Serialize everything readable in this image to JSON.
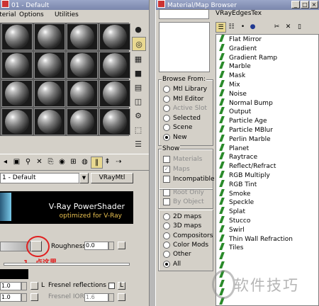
{
  "left_window": {
    "title": "01 - Default",
    "menu": [
      "Material",
      "Options",
      "Utilities"
    ],
    "sample_slot_count": 16,
    "side_tools": [
      "sample-type-sphere-icon",
      "backlight-icon",
      "checker-background-icon",
      "uv-tiling-icon",
      "video-check-icon",
      "make-preview-icon",
      "options-icon",
      "select-by-material-icon",
      "material-navigator-icon"
    ],
    "toolbar_icons": [
      "get-material-icon",
      "put-material-icon",
      "assign-icon",
      "reset-icon",
      "copy-icon",
      "unique-icon",
      "put-library-icon",
      "effect-channel-icon",
      "show-map-icon",
      "show-end-result-icon",
      "go-parent-icon",
      "go-forward-icon"
    ],
    "material_name": "1 - Default",
    "material_type": "VRayMtl",
    "banner": {
      "title": "V-Ray PowerShader",
      "subtitle": "optimized for V-Ray"
    },
    "roughness": {
      "label": "Roughness",
      "value": "0.0"
    },
    "annotation": "1、点这里",
    "fresnel_label": "Fresnel reflections",
    "fresnel_ior_label": "Fresnel IOR",
    "fresnel_ior_value": "1.6",
    "lock_label": "L",
    "value_a": "1.0",
    "value_b": "1.0"
  },
  "right_window": {
    "title": "Material/Map Browser",
    "current_type": "VRayEdgesTex",
    "browse_from": {
      "title": "Browse From:",
      "options": [
        "Mtl Library",
        "Mtl Editor",
        "Active Slot",
        "Selected",
        "Scene",
        "New"
      ],
      "selected": "New",
      "disabled": [
        "Active Slot"
      ]
    },
    "show": {
      "title": "Show",
      "options": [
        {
          "label": "Materials",
          "checked": false,
          "disabled": true
        },
        {
          "label": "Maps",
          "checked": true,
          "disabled": true
        },
        {
          "label": "Incompatible",
          "checked": false,
          "disabled": false
        }
      ]
    },
    "root_options": [
      {
        "label": "Root Only",
        "disabled": true
      },
      {
        "label": "By Object",
        "disabled": true
      }
    ],
    "map_categories": {
      "options": [
        "2D maps",
        "3D maps",
        "Compositors",
        "Color Mods",
        "Other",
        "All"
      ],
      "selected": "All"
    },
    "toolbar_icons": [
      "view-list-icon",
      "view-list-icons-icon",
      "view-small-icons-icon",
      "view-large-icons-icon",
      "delete-from-library-icon",
      "clear-library-icon"
    ],
    "maps": [
      "Flat Mirror",
      "Gradient",
      "Gradient Ramp",
      "Marble",
      "Mask",
      "Mix",
      "Noise",
      "Normal Bump",
      "Output",
      "Particle Age",
      "Particle MBlur",
      "Perlin Marble",
      "Planet",
      "Raytrace",
      "Reflect/Refract",
      "RGB Multiply",
      "RGB Tint",
      "Smoke",
      "Speckle",
      "Splat",
      "Stucco",
      "Swirl",
      "Thin Wall Refraction",
      "Tiles"
    ]
  },
  "watermark": "软件技巧",
  "colors": {
    "annotation": "#e02020",
    "map_icon": "#2a8a2a",
    "banner_subtitle": "#e8c050"
  }
}
